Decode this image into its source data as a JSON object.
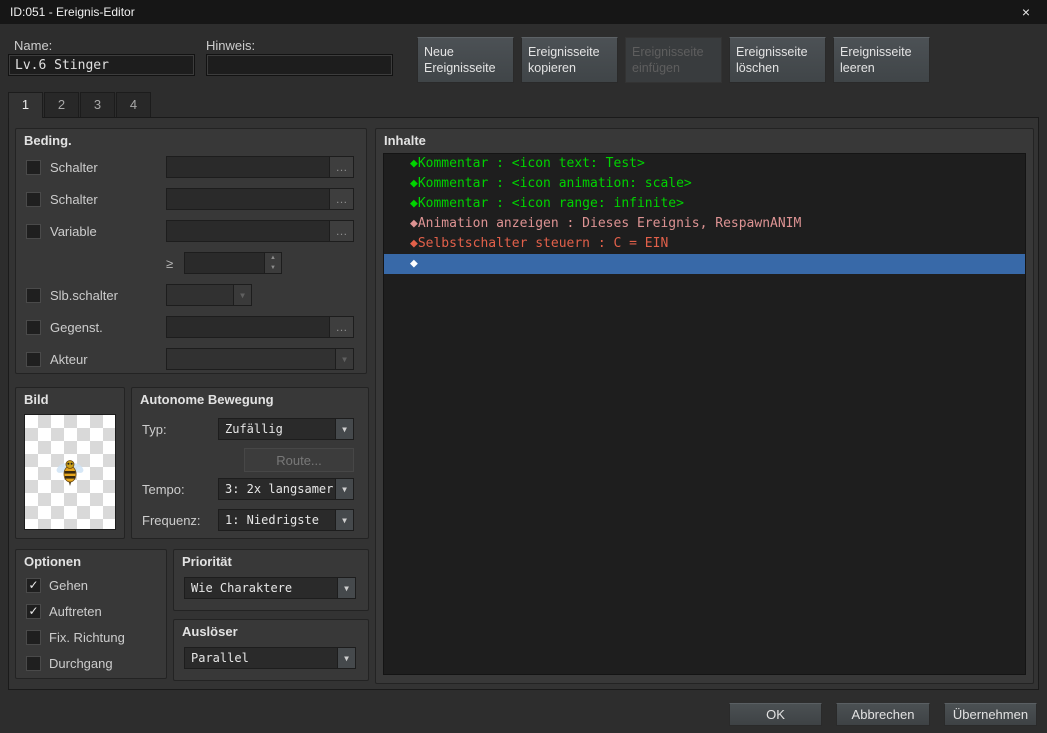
{
  "window": {
    "title": "ID:051 - Ereignis-Editor",
    "close": "×"
  },
  "header": {
    "name_label": "Name:",
    "name_value": "Lv.6 Stinger",
    "note_label": "Hinweis:",
    "note_value": ""
  },
  "page_buttons": [
    {
      "label": "Neue Ereignisseite",
      "disabled": false
    },
    {
      "label": "Ereignisseite kopieren",
      "disabled": false
    },
    {
      "label": "Ereignisseite einfügen",
      "disabled": true
    },
    {
      "label": "Ereignisseite löschen",
      "disabled": false
    },
    {
      "label": "Ereignisseite leeren",
      "disabled": false
    }
  ],
  "tabs": [
    "1",
    "2",
    "3",
    "4"
  ],
  "conditions": {
    "title": "Beding.",
    "browse": "…",
    "switch1": {
      "label": "Schalter",
      "checked": false,
      "value": ""
    },
    "switch2": {
      "label": "Schalter",
      "checked": false,
      "value": ""
    },
    "variable": {
      "label": "Variable",
      "checked": false,
      "value": "",
      "operator": "≥",
      "amount": ""
    },
    "self_switch": {
      "label": "Slb.schalter",
      "checked": false,
      "value": ""
    },
    "item": {
      "label": "Gegenst.",
      "checked": false,
      "value": ""
    },
    "actor": {
      "label": "Akteur",
      "checked": false,
      "value": ""
    }
  },
  "image": {
    "title": "Bild"
  },
  "movement": {
    "title": "Autonome Bewegung",
    "type_label": "Typ:",
    "type_value": "Zufällig",
    "route_button": "Route...",
    "speed_label": "Tempo:",
    "speed_value": "3: 2x langsamer",
    "freq_label": "Frequenz:",
    "freq_value": "1: Niedrigste"
  },
  "options": {
    "title": "Optionen",
    "items": [
      {
        "label": "Gehen",
        "checked": true
      },
      {
        "label": "Auftreten",
        "checked": true
      },
      {
        "label": "Fix. Richtung",
        "checked": false
      },
      {
        "label": "Durchgang",
        "checked": false
      }
    ]
  },
  "priority": {
    "title": "Priorität",
    "value": "Wie Charaktere"
  },
  "trigger": {
    "title": "Auslöser",
    "value": "Parallel"
  },
  "contents": {
    "title": "Inhalte",
    "lines": [
      {
        "text": "◆Kommentar : <icon text: Test>",
        "color": "#00d300",
        "selected": false
      },
      {
        "text": "◆Kommentar : <icon animation: scale>",
        "color": "#00d300",
        "selected": false
      },
      {
        "text": "◆Kommentar : <icon range: infinite>",
        "color": "#00d300",
        "selected": false
      },
      {
        "text": "◆Animation anzeigen : Dieses Ereignis, RespawnANIM",
        "color": "#dd9393",
        "selected": false
      },
      {
        "text": "◆Selbstschalter steuern : C = EIN",
        "color": "#e2604a",
        "selected": false
      },
      {
        "text": "◆",
        "color": "#ffffff",
        "selected": true
      }
    ]
  },
  "footer": {
    "ok": "OK",
    "cancel": "Abbrechen",
    "apply": "Übernehmen"
  },
  "colors": {
    "selection": "#3869a8",
    "comment_green": "#00d300",
    "animation_pink": "#dd9393",
    "self_switch_red": "#e2604a"
  }
}
